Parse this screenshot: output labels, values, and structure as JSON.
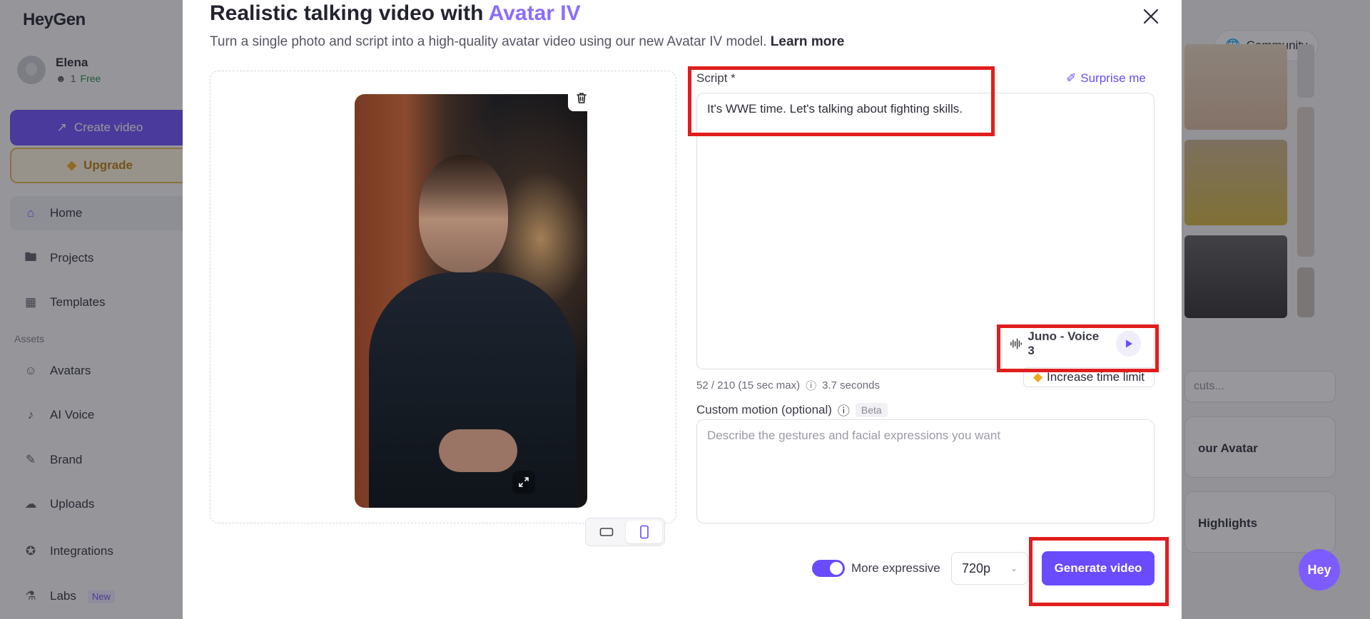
{
  "app": {
    "logo": "HeyGen"
  },
  "user": {
    "name": "Elena",
    "seats": "1",
    "plan": "Free"
  },
  "sidebar": {
    "create_label": "Create video",
    "upgrade_label": "Upgrade",
    "assets_label": "Assets",
    "items": [
      {
        "label": "Home",
        "icon": "home-icon"
      },
      {
        "label": "Projects",
        "icon": "folder-icon"
      },
      {
        "label": "Templates",
        "icon": "templates-icon"
      },
      {
        "label": "Avatars",
        "icon": "avatar-icon"
      },
      {
        "label": "AI Voice",
        "icon": "voice-icon"
      },
      {
        "label": "Brand",
        "icon": "brand-icon"
      },
      {
        "label": "Uploads",
        "icon": "upload-icon"
      },
      {
        "label": "Integrations",
        "icon": "puzzle-icon"
      },
      {
        "label": "Labs",
        "icon": "flask-icon",
        "badge": "New"
      }
    ]
  },
  "right_panel": {
    "community_label": "Community",
    "search_partial": "cuts...",
    "card1": "our Avatar",
    "card2": "Highlights",
    "fab_label": "Hey"
  },
  "modal": {
    "title_main": "Realistic talking video with ",
    "title_accent": "Avatar IV",
    "subtitle": "Turn a single photo and script into a high-quality avatar video using our new Avatar IV model. ",
    "learn_more": "Learn more",
    "script": {
      "label": "Script *",
      "surprise": "Surprise me",
      "text": "It's WWE time. Let's talking about fighting skills.",
      "voice": "Juno - Voice 3",
      "char_count": "52 / 210 (15 sec max)",
      "duration": "3.7 seconds",
      "increase_limit": "Increase time limit"
    },
    "motion": {
      "label": "Custom motion (optional)",
      "badge": "Beta",
      "placeholder": "Describe the gestures and facial expressions you want"
    },
    "expressive_label": "More expressive",
    "expressive_on": true,
    "resolution": "720p",
    "generate_label": "Generate video"
  },
  "colors": {
    "accent": "#6a4bfd",
    "highlight": "#e01e1e"
  }
}
